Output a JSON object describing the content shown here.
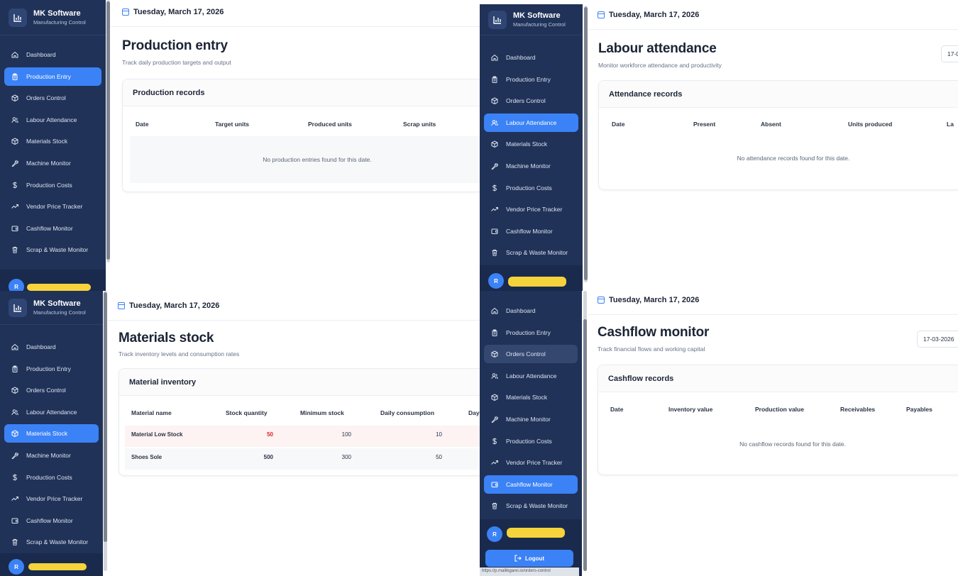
{
  "brand": {
    "name": "MK Software",
    "subtitle": "Manufacturing Control"
  },
  "nav": [
    {
      "label": "Dashboard",
      "icon": "home-icon"
    },
    {
      "label": "Production Entry",
      "icon": "clipboard-icon"
    },
    {
      "label": "Orders Control",
      "icon": "box-icon"
    },
    {
      "label": "Labour Attendance",
      "icon": "users-icon"
    },
    {
      "label": "Materials Stock",
      "icon": "box-icon"
    },
    {
      "label": "Machine Monitor",
      "icon": "wrench-icon"
    },
    {
      "label": "Production Costs",
      "icon": "dollar-icon"
    },
    {
      "label": "Vendor Price Tracker",
      "icon": "trending-up-icon"
    },
    {
      "label": "Cashflow Monitor",
      "icon": "wallet-icon"
    },
    {
      "label": "Scrap & Waste Monitor",
      "icon": "trash-icon"
    }
  ],
  "user": {
    "initial": "R"
  },
  "date": "Tuesday, March 17, 2026",
  "date_input": "17-03-2026",
  "date_input_cut": "17-0",
  "logout_label": "Logout",
  "status_url": "https://p.mallikgarei.io/orders-control",
  "production": {
    "title": "Production entry",
    "subtitle": "Track daily production targets and output",
    "card_title": "Production records",
    "columns": [
      "Date",
      "Target units",
      "Produced units",
      "Scrap units"
    ],
    "empty": "No production entries found for this date."
  },
  "labour": {
    "title": "Labour attendance",
    "subtitle": "Monitor workforce attendance and productivity",
    "card_title": "Attendance records",
    "columns": [
      "Date",
      "Present",
      "Absent",
      "Units produced",
      "La"
    ],
    "empty": "No attendance records found for this date."
  },
  "materials": {
    "title": "Materials stock",
    "subtitle": "Track inventory levels and consumption rates",
    "card_title": "Material inventory",
    "columns": [
      "Material name",
      "Stock quantity",
      "Minimum stock",
      "Daily consumption",
      "Day"
    ],
    "rows": [
      {
        "name": "Material Low Stock",
        "stock": "50",
        "minimum": "100",
        "daily": "10"
      },
      {
        "name": "Shoes Sole",
        "stock": "500",
        "minimum": "300",
        "daily": "50"
      }
    ],
    "low_color": "#e02424"
  },
  "cashflow": {
    "title": "Cashflow monitor",
    "subtitle": "Track financial flows and working capital",
    "card_title": "Cashflow records",
    "columns": [
      "Date",
      "Inventory value",
      "Production value",
      "Receivables",
      "Payables"
    ],
    "empty": "No cashflow records found for this date."
  },
  "colors": {
    "sidebar": "#203258",
    "accent": "#3b82f6",
    "highlight": "#f6d33b"
  }
}
